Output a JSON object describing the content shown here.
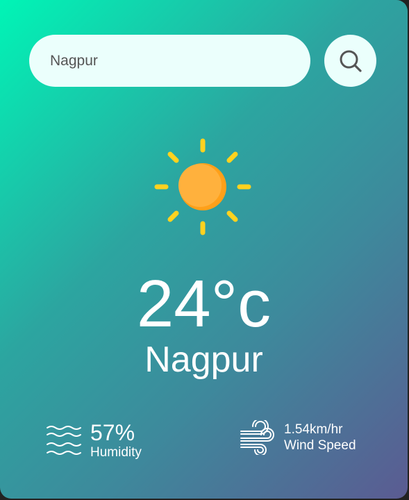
{
  "search": {
    "value": "Nagpur",
    "button_icon": "search-icon"
  },
  "weather": {
    "icon": "sun-icon",
    "temperature": "24°c",
    "city": "Nagpur"
  },
  "humidity": {
    "icon": "humidity-waves-icon",
    "value": "57%",
    "label": "Humidity"
  },
  "wind": {
    "icon": "wind-icon",
    "value": "1.54km/hr",
    "label": "Wind Speed"
  },
  "colors": {
    "card_gradient_start": "#00f5b6",
    "card_gradient_end": "#5b5b92",
    "input_background": "#ebfffc",
    "sun_rays": "#ffd21f",
    "sun_body": "#ffb13d"
  }
}
